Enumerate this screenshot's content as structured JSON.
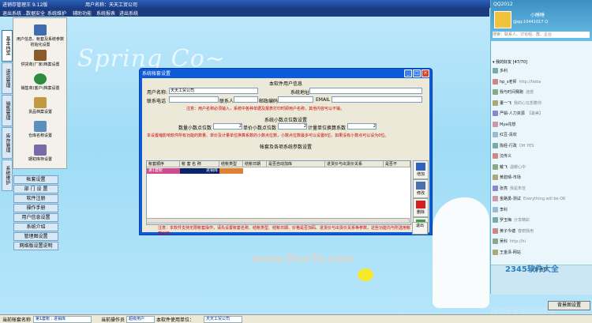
{
  "window": {
    "title": "进销存管理王 9.12版",
    "user_label": "用户名称：天天工贸公司"
  },
  "menu": [
    "退出系统 ...",
    "数据安全",
    "系统维护",
    "辅助功能",
    "系统报表",
    "进出系统"
  ],
  "background": {
    "brand": "Spring Co~"
  },
  "vtabs": [
    "基本档案",
    "进货管理",
    "销售管理",
    "库存管理",
    "系统维护"
  ],
  "left_items": [
    "用户信息、帐套及系统参数初始化设置",
    "供货商(厂家)档案设置",
    "销售商(客户)档案设置",
    "货品档案设置",
    "仓库名称设置",
    "期初库存设置"
  ],
  "left_buttons": [
    "帐套设置",
    "部 门 设 置",
    "软件注册",
    "操作手册",
    "用户信息设置",
    "系统介绍",
    "管理图设置",
    "网络版设置说明"
  ],
  "dialog": {
    "title": "系统帐套设置",
    "sec1": "本软件用户信息",
    "user_name_label": "用户名称:",
    "user_name_value": "天天工贸公司",
    "address_label": "系统地址",
    "phone_label": "联系电话",
    "contact_label": "联系人",
    "zip_label": "邮政编码",
    "email_label": "EMAIL",
    "note1": "注意：用户名称必须输入，系统中各种单据及报表打印时即用户名称，其他内容可以不输。",
    "sec2": "系统小数点位数设置",
    "qty_label": "数量小数点位数",
    "qty_value": "2",
    "price_label": "单价小数点位数",
    "price_value": "2",
    "unit_label": "计量单位换算系数",
    "unit_value": "2",
    "note2": "本设置缩影响软件所有功能的数量、单价及计量单位换算系数的小数点位数，小数点位数最多可以设置6位，如果没有小数点可以设为0位。",
    "sec3": "帐套及各项系统参数设置",
    "grid_headers": [
      "帐套顺序",
      "帐 套 名 称",
      "结帐类型",
      "结帐日期",
      "是否自动加库",
      "进货价与出货价关系",
      "是否不"
    ],
    "grid_row": [
      "第1套帐",
      "进销库",
      "",
      "",
      "",
      "",
      ""
    ],
    "note3": "注意：本软件支持无限帐套操作，请先设置帐套名称、结帐类型、结帐日期、价格是否加码、进货价与出货价关系等参数，这些功能均与所选用帐套对应。",
    "side_buttons": [
      "增加",
      "修改",
      "删除",
      "帮助",
      "退出"
    ],
    "watermark": "www.DuoTe.com"
  },
  "qq": {
    "title": "QQ2012",
    "nick": "小睡睡",
    "signature": "@qq:10441017 Q",
    "search_placeholder": "搜索：联系人、讨论组、群、企业",
    "group_label": "▾ 我的好友 [47/70]",
    "contacts": [
      {
        "name": "多利",
        "sig": ""
      },
      {
        "name": "hp_s老师",
        "sig": "http://tieba"
      },
      {
        "name": "我与时间赛跑",
        "sig": "迷惑"
      },
      {
        "name": "董一飞",
        "sig": "我的心在想着你"
      },
      {
        "name": "严娟-人力资源",
        "sig": "【最美】"
      },
      {
        "name": "Mya花想",
        "sig": ""
      },
      {
        "name": "红豆-清欢",
        "sig": ""
      },
      {
        "name": "陈经-行政",
        "sig": "OH YES"
      },
      {
        "name": "沈传义",
        "sig": ""
      },
      {
        "name": "戴飞",
        "sig": "温暖心中"
      },
      {
        "name": "黄碧晴-市场",
        "sig": ""
      },
      {
        "name": "张亮",
        "sig": "我是朱曾"
      },
      {
        "name": "金路勇-测试",
        "sig": "Everything will be OK"
      },
      {
        "name": "李科",
        "sig": ""
      },
      {
        "name": "罗玉梅",
        "sig": "分享精彩"
      },
      {
        "name": "黄子今塘",
        "sig": "春丽我用"
      },
      {
        "name": "吴科",
        "sig": "http://hi"
      },
      {
        "name": "王金泽-网站",
        "sig": ""
      }
    ],
    "bottom_menu": "设置  查找",
    "brand": "2345软件大全",
    "brand2": "国内最安全的软件站"
  },
  "status": {
    "account_label": "当前帐套名称",
    "account_value": "第1套帐 : 进销库",
    "op_label": "当前操作员",
    "op_value": "超级用户",
    "company_label": "本软件使用单位：",
    "company_value": "天天工贸公司",
    "right_button": "背景图设置"
  }
}
